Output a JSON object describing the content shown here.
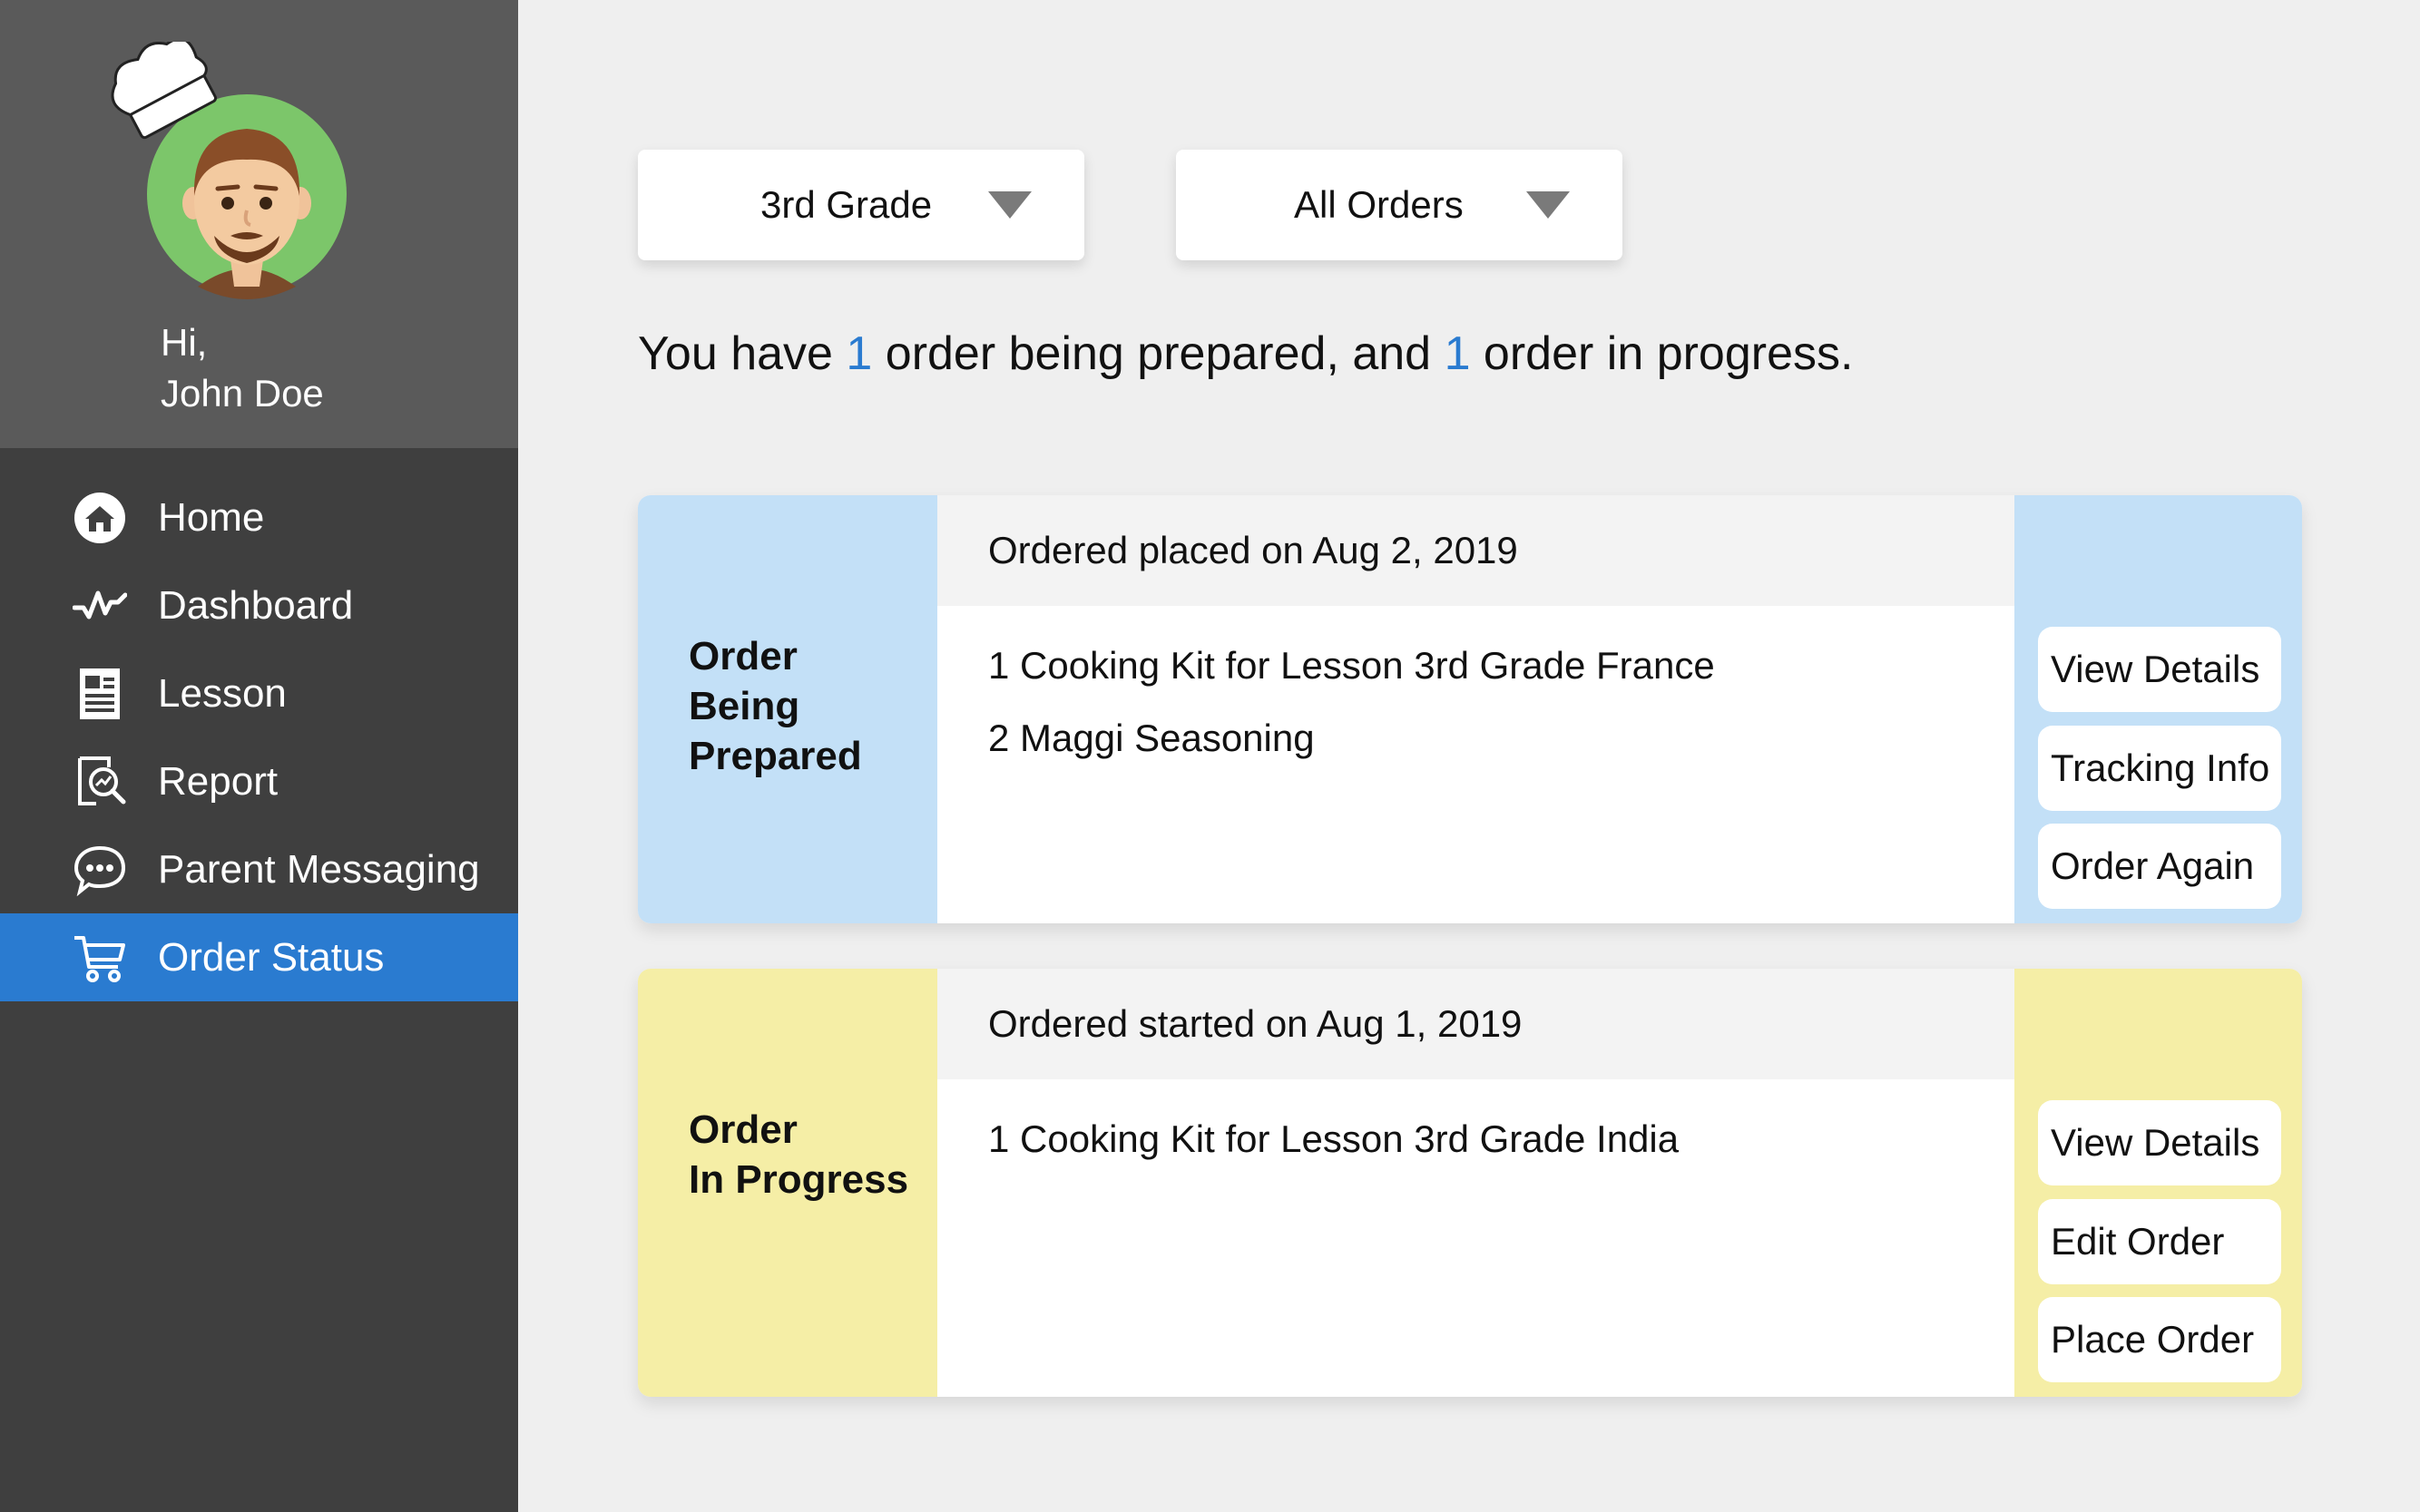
{
  "user": {
    "greeting": "Hi,",
    "name": "John Doe"
  },
  "nav": [
    {
      "label": "Home",
      "icon": "home-icon",
      "active": false
    },
    {
      "label": "Dashboard",
      "icon": "pulse-icon",
      "active": false
    },
    {
      "label": "Lesson",
      "icon": "document-icon",
      "active": false
    },
    {
      "label": "Report",
      "icon": "report-icon",
      "active": false
    },
    {
      "label": "Parent Messaging",
      "icon": "chat-icon",
      "active": false
    },
    {
      "label": "Order Status",
      "icon": "cart-icon",
      "active": true
    }
  ],
  "filters": {
    "grade": {
      "value": "3rd Grade"
    },
    "orders": {
      "value": "All Orders"
    }
  },
  "summary": {
    "part1": "You have ",
    "count1": "1",
    "part2": " order being prepared, and ",
    "count2": "1",
    "part3": " order in progress."
  },
  "cards": [
    {
      "status_line1": "Order",
      "status_line2": "Being",
      "status_line3": "Prepared",
      "date": "Ordered placed on Aug 2, 2019",
      "items": [
        "1 Cooking Kit for Lesson 3rd Grade France",
        "2 Maggi Seasoning"
      ],
      "actions": [
        "View Details",
        "Tracking Info",
        "Order Again"
      ],
      "color": "#c3e0f7"
    },
    {
      "status_line1": "Order",
      "status_line2": "In Progress",
      "date": "Ordered started on Aug 1, 2019",
      "items": [
        "1 Cooking Kit for Lesson 3rd Grade India"
      ],
      "actions": [
        "View Details",
        "Edit Order",
        "Place Order"
      ],
      "color": "#f5eea6"
    }
  ],
  "colors": {
    "sidebar": "#3f3f3f",
    "profile": "#5a5a5a",
    "active_nav": "#2a7bd0",
    "accent_number": "#2a7bd0"
  }
}
